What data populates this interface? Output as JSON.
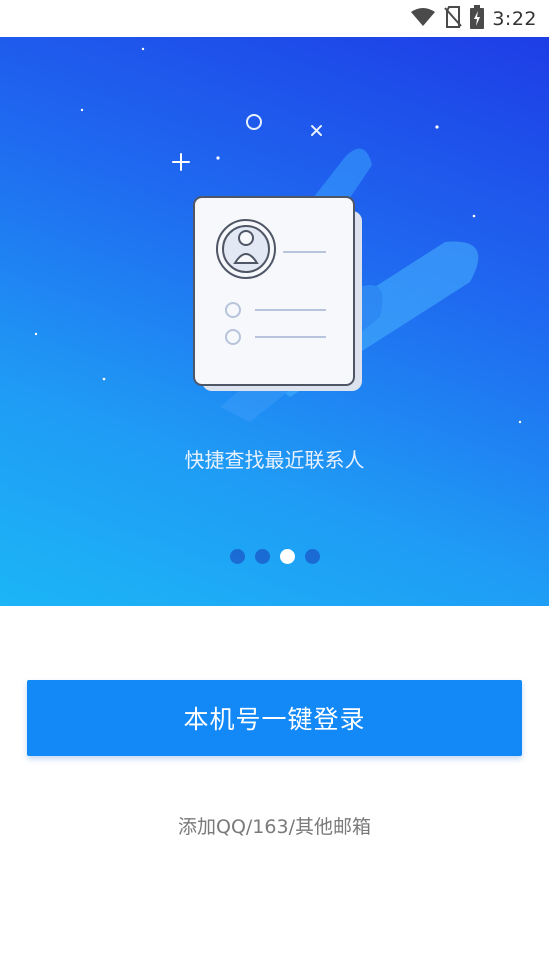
{
  "status_bar": {
    "time": "3:22",
    "icons": [
      "wifi-icon",
      "no-sim-icon",
      "battery-charging-icon"
    ]
  },
  "hero": {
    "caption": "快捷查找最近联系人",
    "illustration": "contact-card-icon",
    "pager": {
      "count": 4,
      "active_index": 2
    }
  },
  "login": {
    "button_label": "本机号一键登录",
    "email_link": "添加QQ/163/其他邮箱"
  },
  "colors": {
    "accent": "#1389f8",
    "hero_top": "#1e3de6",
    "hero_bottom": "#1cb5f6"
  }
}
